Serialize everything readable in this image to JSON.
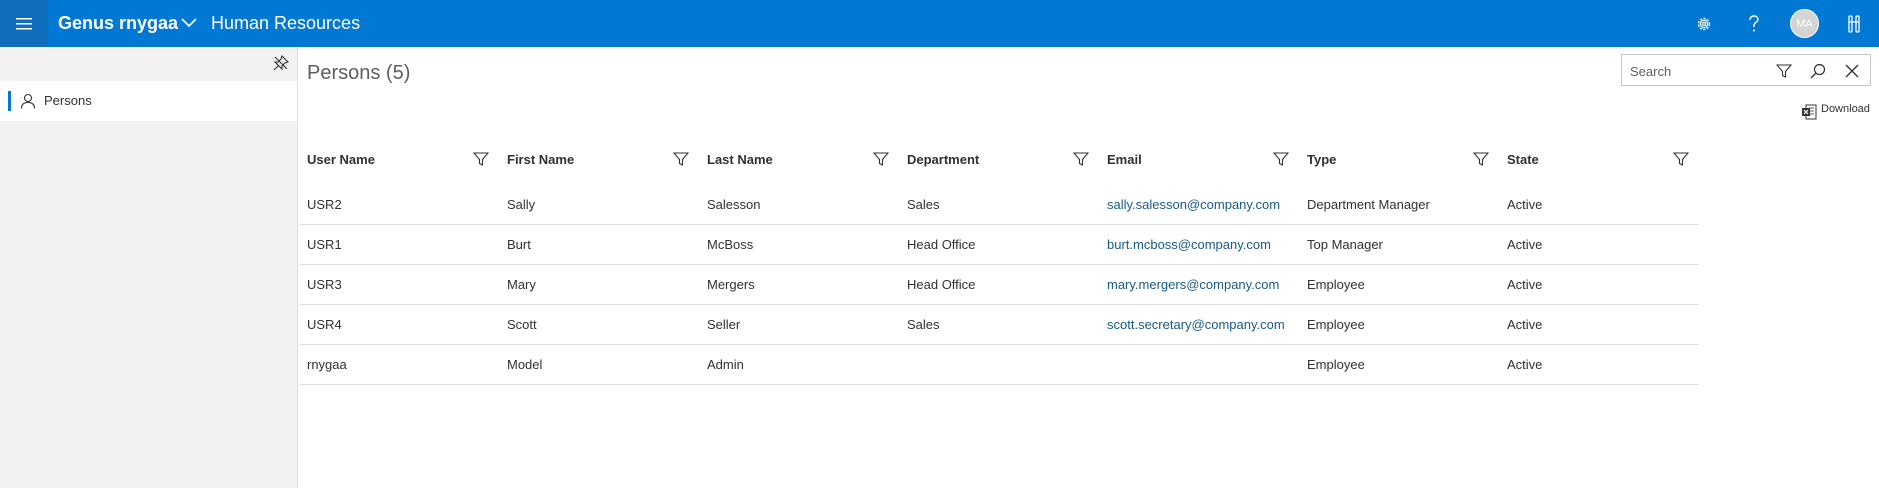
{
  "header": {
    "app_title": "Genus rnygaa",
    "module_title": "Human Resources",
    "avatar_initials": "MA",
    "colors": {
      "bar": "#0078d4",
      "hamburger_bg": "#106ebe"
    },
    "icons": [
      "hamburger-icon",
      "chevron-down-icon",
      "gear-icon",
      "help-icon",
      "tools-icon"
    ]
  },
  "sidebar": {
    "items": [
      {
        "label": "Persons",
        "icon": "person-icon",
        "selected": true
      }
    ]
  },
  "main": {
    "title": "Persons (5)",
    "search": {
      "placeholder": "Search",
      "value": ""
    },
    "download_label": "Download"
  },
  "grid": {
    "columns": [
      "User Name",
      "First Name",
      "Last Name",
      "Department",
      "Email",
      "Type",
      "State"
    ],
    "rows": [
      [
        "USR2",
        "Sally",
        "Salesson",
        "Sales",
        "sally.salesson@company.com",
        "Department Manager",
        "Active"
      ],
      [
        "USR1",
        "Burt",
        "McBoss",
        "Head Office",
        "burt.mcboss@company.com",
        "Top Manager",
        "Active"
      ],
      [
        "USR3",
        "Mary",
        "Mergers",
        "Head Office",
        "mary.mergers@company.com",
        "Employee",
        "Active"
      ],
      [
        "USR4",
        "Scott",
        "Seller",
        "Sales",
        "scott.secretary@company.com",
        "Employee",
        "Active"
      ],
      [
        "rnygaa",
        "Model",
        "Admin",
        "",
        "",
        "Employee",
        "Active"
      ]
    ]
  }
}
